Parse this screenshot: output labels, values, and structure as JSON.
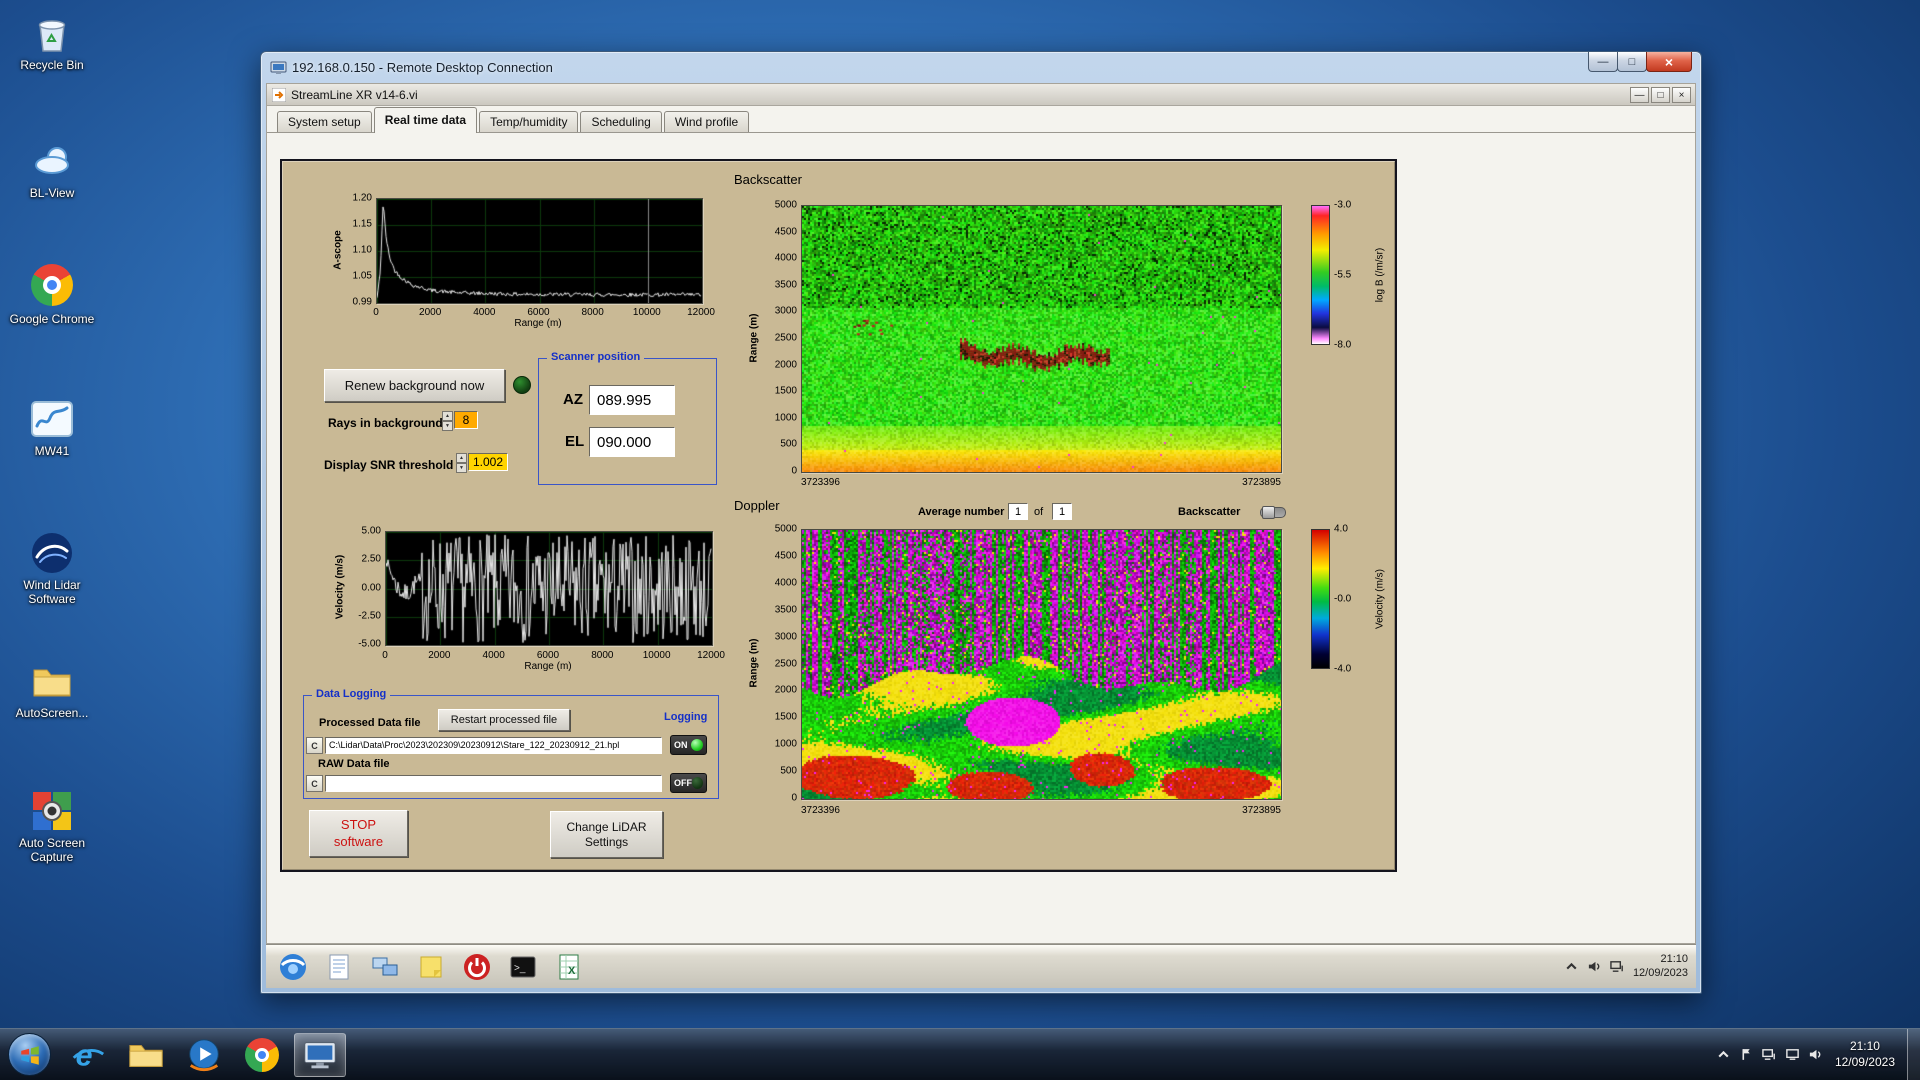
{
  "desktop": {
    "icons": [
      {
        "name": "recycle-bin",
        "label": "Recycle Bin"
      },
      {
        "name": "bl-view",
        "label": "BL-View"
      },
      {
        "name": "google-chrome",
        "label": "Google Chrome"
      },
      {
        "name": "mw41",
        "label": "MW41"
      },
      {
        "name": "wind-lidar",
        "label": "Wind Lidar Software"
      },
      {
        "name": "autoscreen-folder",
        "label": "AutoScreen..."
      },
      {
        "name": "auto-screen-capture",
        "label": "Auto Screen Capture"
      }
    ]
  },
  "rdp_window": {
    "title": "192.168.0.150 - Remote Desktop Connection"
  },
  "app_window": {
    "title": "StreamLine XR v14-6.vi",
    "tabs": [
      {
        "label": "System setup",
        "active": false
      },
      {
        "label": "Real time data",
        "active": true
      },
      {
        "label": "Temp/humidity",
        "active": false
      },
      {
        "label": "Scheduling",
        "active": false
      },
      {
        "label": "Wind profile",
        "active": false
      }
    ]
  },
  "panel": {
    "ascope": {
      "ylabel": "A-scope",
      "xlabel": "Range (m)",
      "y_ticks": [
        "1.20",
        "1.15",
        "1.10",
        "1.05",
        "0.99"
      ],
      "x_ticks": [
        "0",
        "2000",
        "4000",
        "6000",
        "8000",
        "10000",
        "12000"
      ]
    },
    "background_controls": {
      "renew_button": "Renew background now",
      "rays_label": "Rays in background",
      "rays_value": "8",
      "snr_label": "Display SNR threshold",
      "snr_value": "1.002"
    },
    "scanner": {
      "title": "Scanner position",
      "az_label": "AZ",
      "az_value": "089.995",
      "el_label": "EL",
      "el_value": "090.000"
    },
    "backscatter": {
      "title": "Backscatter",
      "ylabel": "Range (m)",
      "y_ticks": [
        "5000",
        "4500",
        "4000",
        "3500",
        "3000",
        "2500",
        "2000",
        "1500",
        "1000",
        "500",
        "0"
      ],
      "x_left": "3723396",
      "x_right": "3723895",
      "colorbar_title": "log B (/m/sr)",
      "colorbar_ticks": [
        "-3.0",
        "-5.5",
        "-8.0"
      ]
    },
    "doppler": {
      "title": "Doppler",
      "average_label": "Average number",
      "average_value": "1",
      "of_label": "of",
      "of_value": "1",
      "toggle_label": "Backscatter",
      "ylabel": "Range (m)",
      "y_ticks": [
        "5000",
        "4500",
        "4000",
        "3500",
        "3000",
        "2500",
        "2000",
        "1500",
        "1000",
        "500",
        "0"
      ],
      "x_left": "3723396",
      "x_right": "3723895",
      "colorbar_title": "Velocity (m/s)",
      "colorbar_ticks": [
        "4.0",
        "-0.0",
        "-4.0"
      ]
    },
    "velocity": {
      "ylabel": "Velocity (m/s)",
      "xlabel": "Range (m)",
      "y_ticks": [
        "5.00",
        "2.50",
        "0.00",
        "-2.50",
        "-5.00"
      ],
      "x_ticks": [
        "0",
        "2000",
        "4000",
        "6000",
        "8000",
        "10000",
        "12000"
      ]
    },
    "data_logging": {
      "title": "Data Logging",
      "processed_label": "Processed Data file",
      "restart_button": "Restart processed file",
      "logging_label": "Logging",
      "drive_button": "C",
      "processed_path": "C:\\Lidar\\Data\\Proc\\2023\\202309\\20230912\\Stare_122_20230912_21.hpl",
      "on_label": "ON",
      "raw_label": "RAW Data file",
      "raw_path": "",
      "off_label": "OFF"
    },
    "stop_button": {
      "line1": "STOP",
      "line2": "software"
    },
    "settings_button": {
      "line1": "Change LiDAR",
      "line2": "Settings"
    }
  },
  "remote_taskbar": {
    "icons": [
      {
        "name": "browser-icon"
      },
      {
        "name": "notepad-icon"
      },
      {
        "name": "network-setup-icon"
      },
      {
        "name": "sticky-notes-icon"
      },
      {
        "name": "power-icon"
      },
      {
        "name": "command-prompt-icon"
      },
      {
        "name": "spreadsheet-icon"
      }
    ],
    "tray_icons": [
      {
        "name": "tray-expand-icon"
      },
      {
        "name": "volume-icon"
      },
      {
        "name": "network-icon"
      }
    ],
    "time": "21:10",
    "date": "12/09/2023"
  },
  "host_taskbar": {
    "icons": [
      {
        "name": "internet-explorer-icon"
      },
      {
        "name": "windows-explorer-icon"
      },
      {
        "name": "media-player-icon"
      },
      {
        "name": "google-chrome-icon"
      },
      {
        "name": "remote-desktop-icon",
        "active": true
      }
    ],
    "tray_icons": [
      {
        "name": "tray-expand-icon"
      },
      {
        "name": "action-center-icon"
      },
      {
        "name": "network-icon"
      },
      {
        "name": "display-icon"
      },
      {
        "name": "volume-icon"
      }
    ],
    "time": "21:10",
    "date": "12/09/2023"
  },
  "chart_data": [
    {
      "type": "line",
      "name": "a-scope",
      "ylabel": "A-scope",
      "xlabel": "Range (m)",
      "xlim": [
        0,
        12000
      ],
      "ylim": [
        0.99,
        1.2
      ],
      "y_ticks": [
        1.2,
        1.15,
        1.1,
        1.05,
        0.99
      ],
      "x_ticks": [
        0,
        2000,
        4000,
        6000,
        8000,
        10000,
        12000
      ],
      "profile": [
        [
          0,
          0.998
        ],
        [
          120,
          1.05
        ],
        [
          230,
          1.198
        ],
        [
          320,
          1.13
        ],
        [
          450,
          1.085
        ],
        [
          650,
          1.055
        ],
        [
          900,
          1.04
        ],
        [
          1300,
          1.025
        ],
        [
          2000,
          1.014
        ],
        [
          3000,
          1.009
        ],
        [
          5000,
          1.006
        ],
        [
          8000,
          1.005
        ],
        [
          12000,
          1.005
        ]
      ],
      "noise": 0.004,
      "cursor_x": 10000
    },
    {
      "type": "heatmap",
      "name": "backscatter",
      "title": "Backscatter",
      "ylabel": "Range (m)",
      "ylim": [
        0,
        5000
      ],
      "x_axis_labels": [
        "3723396",
        "3723895"
      ],
      "colorbar": {
        "title": "log B (/m/sr)",
        "tick_values": [
          -3.0,
          -5.5,
          -8.0
        ]
      },
      "features": {
        "aerosol_layer_range_m": [
          2000,
          2400
        ],
        "aerosol_layer_x_extent": [
          0.33,
          0.64
        ],
        "isolated_echo_x_extent": [
          0.1,
          0.19
        ],
        "isolated_echo_range_m": [
          2600,
          2900
        ],
        "surface_layer_top_m": 450
      }
    },
    {
      "type": "line",
      "name": "velocity",
      "ylabel": "Velocity (m/s)",
      "xlabel": "Range (m)",
      "xlim": [
        0,
        12000
      ],
      "ylim": [
        -5,
        5
      ],
      "y_ticks": [
        5.0,
        2.5,
        0.0,
        -2.5,
        -5.0
      ],
      "x_ticks": [
        0,
        2000,
        4000,
        6000,
        8000,
        10000,
        12000
      ],
      "signal": {
        "near_range_peak": 2.8,
        "coherent_max_range_m": 1300,
        "noise_amplitude": 4.9
      }
    },
    {
      "type": "heatmap",
      "name": "doppler",
      "title": "Doppler",
      "ylabel": "Range (m)",
      "ylim": [
        0,
        5000
      ],
      "x_axis_labels": [
        "3723396",
        "3723895"
      ],
      "colorbar": {
        "title": "Velocity (m/s)",
        "tick_values": [
          4.0,
          -0.0,
          -4.0
        ]
      },
      "features": {
        "signal_top_range_m": 2300,
        "magenta_patch": {
          "x": 0.44,
          "range_m": 1450,
          "rx": 0.09,
          "range_sigma_m": 420
        },
        "red_patches": [
          {
            "x": 0.1,
            "range_m": 350,
            "rx": 0.13,
            "range_sigma_m": 420
          },
          {
            "x": 0.4,
            "range_m": 250,
            "rx": 0.1,
            "range_sigma_m": 330
          },
          {
            "x": 0.62,
            "range_m": 520,
            "rx": 0.08,
            "range_sigma_m": 330
          },
          {
            "x": 0.86,
            "range_m": 320,
            "rx": 0.11,
            "range_sigma_m": 330
          }
        ]
      }
    }
  ]
}
